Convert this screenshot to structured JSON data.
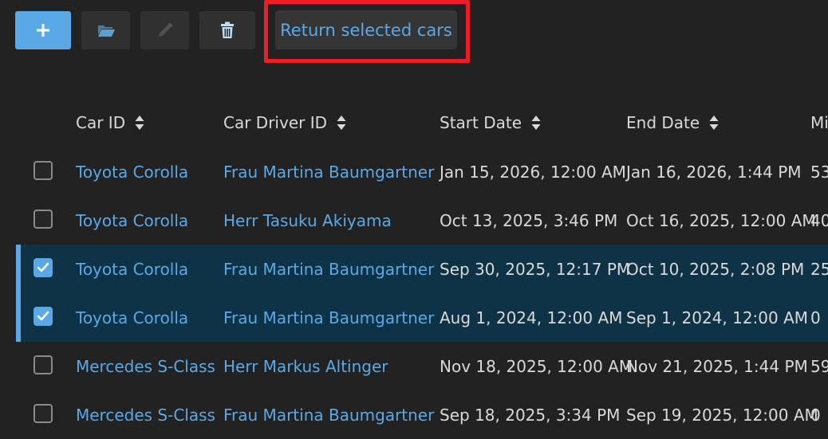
{
  "toolbar": {
    "add_icon": "plus-icon",
    "open_icon": "folder-icon",
    "edit_icon": "pencil-icon",
    "delete_icon": "trash-icon",
    "return_label": "Return selected cars"
  },
  "colors": {
    "accent": "#5aa9e6",
    "highlight": "#ee1c24",
    "selected_row": "#0f3346"
  },
  "table": {
    "headers": [
      "Car ID",
      "Car Driver ID",
      "Start Date",
      "End Date",
      "Mi"
    ],
    "rows": [
      {
        "selected": false,
        "car": "Toyota Corolla",
        "driver": "Frau Martina Baumgartner",
        "start": "Jan 15, 2026, 12:00 AM",
        "end": "Jan 16, 2026, 1:44 PM",
        "mi": "53"
      },
      {
        "selected": false,
        "car": "Toyota Corolla",
        "driver": "Herr Tasuku Akiyama",
        "start": "Oct 13, 2025, 3:46 PM",
        "end": "Oct 16, 2025, 12:00 AM",
        "mi": "40"
      },
      {
        "selected": true,
        "car": "Toyota Corolla",
        "driver": "Frau Martina Baumgartner",
        "start": "Sep 30, 2025, 12:17 PM",
        "end": "Oct 10, 2025, 2:08 PM",
        "mi": "25"
      },
      {
        "selected": true,
        "car": "Toyota Corolla",
        "driver": "Frau Martina Baumgartner",
        "start": "Aug 1, 2024, 12:00 AM",
        "end": "Sep 1, 2024, 12:00 AM",
        "mi": "0"
      },
      {
        "selected": false,
        "car": "Mercedes S-Class",
        "driver": "Herr Markus Altinger",
        "start": "Nov 18, 2025, 12:00 AM",
        "end": "Nov 21, 2025, 1:44 PM",
        "mi": "59"
      },
      {
        "selected": false,
        "car": "Mercedes S-Class",
        "driver": "Frau Martina Baumgartner",
        "start": "Sep 18, 2025, 3:34 PM",
        "end": "Sep 19, 2025, 12:00 AM",
        "mi": "0"
      }
    ]
  }
}
